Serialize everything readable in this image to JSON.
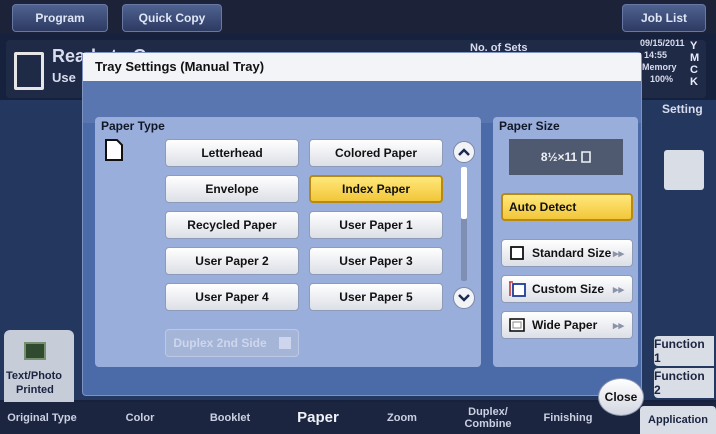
{
  "top_tabs": [
    "Program",
    "Quick Copy",
    "Job List"
  ],
  "background": {
    "ready_text": "Ready to Copy",
    "sub_text": "Use",
    "num_sets": "No. of Sets",
    "date": "09/15/2011",
    "time": "14:55",
    "memory": "Memory",
    "memory_pct": "100%",
    "toner": [
      "Y",
      "M",
      "C",
      "K"
    ],
    "setting": "Setting",
    "function1": "Function 1",
    "function2": "Function 2",
    "original_label": "Text/Photo",
    "original_label2": "Printed"
  },
  "bottom_tabs": [
    "Original Type",
    "Color",
    "Booklet",
    "Paper",
    "Zoom",
    "Duplex/ Combine",
    "Finishing",
    "Application"
  ],
  "dialog": {
    "title": "Tray Settings (Manual Tray)",
    "paper_type": {
      "title": "Paper Type",
      "buttons": [
        {
          "label": "Letterhead",
          "selected": false
        },
        {
          "label": "Colored Paper",
          "selected": false
        },
        {
          "label": "Envelope",
          "selected": false
        },
        {
          "label": "Index Paper",
          "selected": true
        },
        {
          "label": "Recycled Paper",
          "selected": false
        },
        {
          "label": "User Paper 1",
          "selected": false
        },
        {
          "label": "User Paper 2",
          "selected": false
        },
        {
          "label": "User Paper 3",
          "selected": false
        },
        {
          "label": "User Paper 4",
          "selected": false
        },
        {
          "label": "User Paper 5",
          "selected": false
        }
      ],
      "duplex_label": "Duplex 2nd Side"
    },
    "paper_size": {
      "title": "Paper Size",
      "display": "8½×11",
      "auto_detect": "Auto Detect",
      "standard": "Standard Size",
      "custom": "Custom Size",
      "wide": "Wide Paper"
    },
    "close": "Close"
  },
  "colors": {
    "selected": "#f2c63a",
    "dialog_bg": "#4b6aa8",
    "panel_bg": "#9aaedb"
  }
}
